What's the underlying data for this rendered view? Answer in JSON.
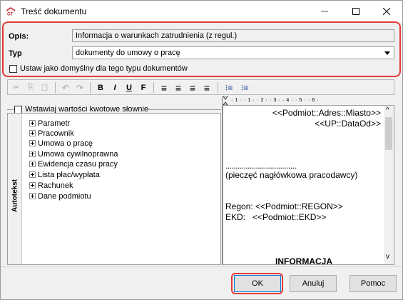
{
  "window": {
    "title": "Treść dokumentu",
    "minimize_symbol": "—",
    "maximize_symbol": "☐",
    "close_symbol": "✕"
  },
  "form": {
    "opis_label": "Opis:",
    "opis_value": "Informacja o warunkach zatrudnienia (z regul.)",
    "typ_label": "Typ",
    "typ_value": "dokumenty do umowy o pracę",
    "default_checkbox_label": "Ustaw jako domyślny dla tego typu dokumentów",
    "default_checked": false
  },
  "toolbar": {
    "cut": "✂",
    "copy": "⎘",
    "paste": "📋",
    "undo": "↶",
    "redo": "↷",
    "bold": "B",
    "italic": "I",
    "underline": "U",
    "font": "F",
    "align_left": "≡",
    "align_center": "≡",
    "align_right": "≡",
    "justify": "≡",
    "bullets": "⁝≡",
    "numbering": "⁝≡"
  },
  "left_panel": {
    "kwoty_checkbox_label": "Wstawiaj wartości kwotowe słownie",
    "kwoty_checked": false,
    "tab_label": "Autotekst",
    "tree_items": [
      "Parametr",
      "Pracownik",
      "Umowa o pracę",
      "Umowa cywilnoprawna",
      "Ewidencja czasu pracy",
      "Lista płac/wypłata",
      "Rachunek",
      "Dane podmiotu"
    ]
  },
  "ruler": {
    "text": "· 1 · · 1 · · 2 · · 3 · · 4 · · 5 · · 6 ·"
  },
  "editor": {
    "line1": "<<Podmiot::Adres::Miasto>>",
    "line2": "<<UP::DataOd>>",
    "dots": "...................................",
    "line3": "(pieczęć nagłówkowa pracodawcy)",
    "line4": "Regon: <<Podmiot::REGON>>",
    "line5": "EKD:   <<Podmiot::EKD>>",
    "line6": "INFORMACJA",
    "scroll_up": "^",
    "scroll_down": "v"
  },
  "footer": {
    "ok_label": "OK",
    "cancel_label": "Anuluj",
    "help_label": "Pomoc"
  },
  "colors": {
    "highlight_red": "#e53935",
    "accent_blue": "#0078d7"
  }
}
